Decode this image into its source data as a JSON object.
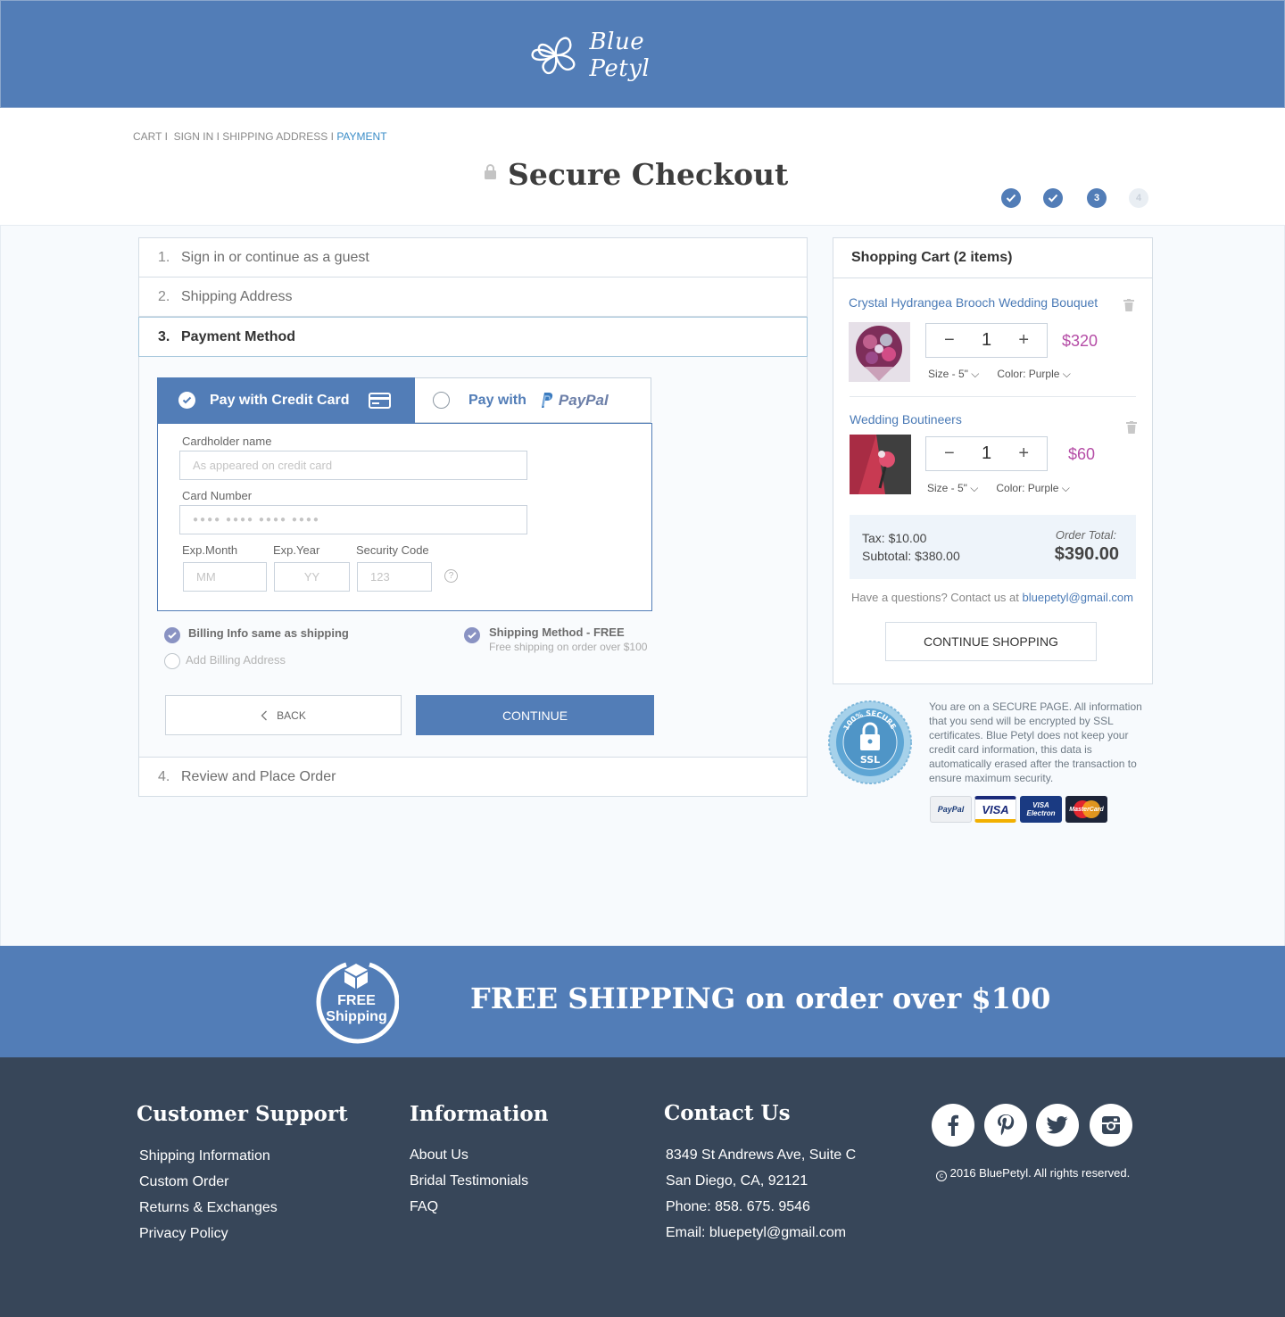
{
  "header": {
    "brand": "Blue Petyl"
  },
  "breadcrumb": {
    "cart": "CART I",
    "sign_in": "SIGN IN I",
    "shipping": "SHIPPING ADDRESS I",
    "payment": "PAYMENT"
  },
  "page_title": "Secure Checkout",
  "progress": {
    "steps": [
      "✓",
      "✓",
      "3",
      "4"
    ],
    "current": 3
  },
  "steps": [
    {
      "num": "1.",
      "label": "Sign in or continue as a guest"
    },
    {
      "num": "2.",
      "label": "Shipping Address"
    },
    {
      "num": "3.",
      "label": "Payment Method"
    },
    {
      "num": "4.",
      "label": "Review and Place Order"
    }
  ],
  "payment": {
    "tab_cc": "Pay with Credit Card",
    "tab_pp_prefix": "Pay with",
    "tab_pp_brand": "PayPal",
    "cardholder_label": "Cardholder name",
    "cardholder_placeholder": "As appeared on credit card",
    "card_number_label": "Card Number",
    "card_number_placeholder": "●●●●   ●●●● ●●●●   ●●●●",
    "exp_month_label": "Exp.Month",
    "exp_month_placeholder": "MM",
    "exp_year_label": "Exp.Year",
    "exp_year_placeholder": "YY",
    "security_label": "Security Code",
    "security_placeholder": "123",
    "billing_same": "Billing Info same as shipping",
    "add_billing": "Add Billing Address",
    "shipping_method": "Shipping Method - FREE",
    "shipping_note": "Free shipping on order over $100",
    "back": "BACK",
    "continue": "CONTINUE"
  },
  "cart": {
    "title": "Shopping Cart (2 items)",
    "items": [
      {
        "name": "Crystal Hydrangea Brooch Wedding Bouquet",
        "qty": "1",
        "price": "$320",
        "size": "Size - 5\"",
        "color": "Color: Purple"
      },
      {
        "name": "Wedding Boutineers",
        "qty": "1",
        "price": "$60",
        "size": "Size - 5\"",
        "color": "Color: Purple"
      }
    ],
    "tax": "Tax: $10.00",
    "subtotal": "Subtotal: $380.00",
    "order_total_label": "Order Total:",
    "order_total": "$390.00",
    "help_prefix": "Have a questions? Contact us at",
    "help_email": "bluepetyl@gmail.com",
    "continue_shopping": "CONTINUE SHOPPING"
  },
  "security": {
    "badge_top": "100% SECURE",
    "badge_bottom": "SSL",
    "text": "You are on a SECURE PAGE. All information that you send will be encrypted by SSL certificates. Blue Petyl does not keep your credit card information, this data is automatically erased after the transaction to ensure maximum security.",
    "logos": [
      "PayPal",
      "VISA",
      "VISA Electron",
      "MasterCard"
    ]
  },
  "banner": {
    "badge_line1": "FREE",
    "badge_line2": "Shipping",
    "text": "FREE SHIPPING on order over $100"
  },
  "footer": {
    "support_title": "Customer Support",
    "support_links": [
      "Shipping Information",
      "Custom Order",
      "Returns & Exchanges",
      "Privacy Policy"
    ],
    "info_title": "Information",
    "info_links": [
      "About Us",
      "Bridal Testimonials",
      "FAQ"
    ],
    "contact_title": "Contact Us",
    "contact_lines": [
      "8349 St Andrews Ave, Suite C",
      "San Diego, CA, 92121",
      "Phone: 858. 675. 9546",
      "Email: bluepetyl@gmail.com"
    ],
    "social": [
      "facebook-icon",
      "pinterest-icon",
      "twitter-icon",
      "instagram-icon"
    ],
    "copyright": "2016 BluePetyl. All rights reserved."
  },
  "colors": {
    "brand_blue": "#527db7",
    "price_magenta": "#b54da6",
    "footer_dark": "#374659",
    "check_purple": "#8a93c3"
  }
}
